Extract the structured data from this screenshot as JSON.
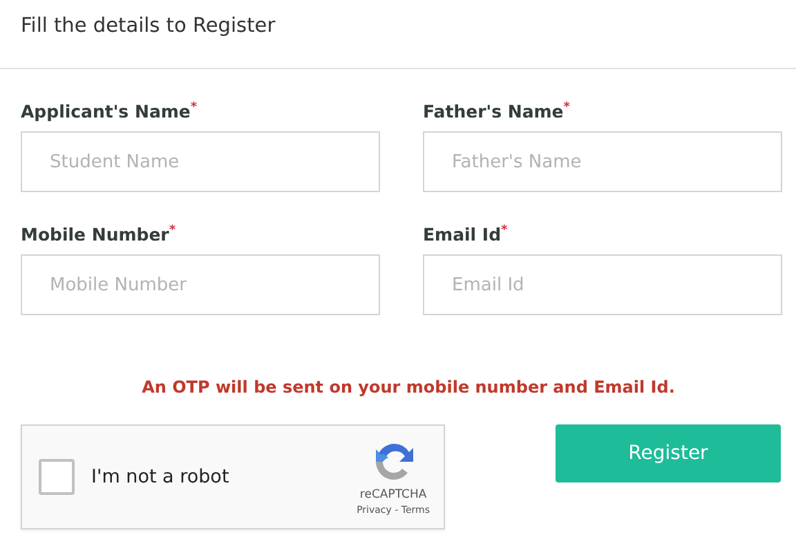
{
  "header": {
    "title": "Fill the details to Register"
  },
  "fields": [
    {
      "label": "Applicant's Name$^{*}$",
      "placeholder": "Student Name"
    },
    {
      "label": "Father's Name$^{*}$",
      "placeholder": "Father's Name"
    },
    {
      "label": "Mobile Number$^{*}$",
      "placeholder": "Mobile Number"
    },
    {
      "label": "Email Id$^{*}$",
      "placeholder": "Email Id"
    }
  ],
  "notice": "An OTP will be sent on your mobile number and Email Id.",
  "captcha": {
    "label": "I'm not a robot",
    "checked": false,
    "brand": "reCAPTCHA",
    "links": "Privacy - Terms"
  },
  "submit_button": "Register"
}
